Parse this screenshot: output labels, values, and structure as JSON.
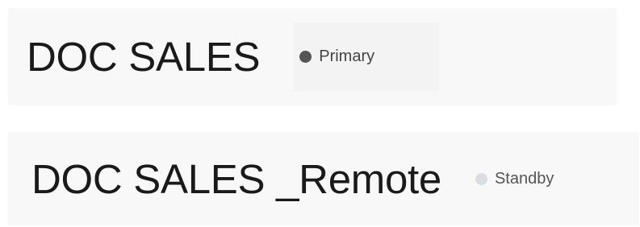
{
  "databases": [
    {
      "name": "DOC SALES",
      "status": "Primary",
      "status_color": "#555555",
      "status_icon": "status-dot-icon"
    },
    {
      "name": "DOC SALES _Remote",
      "status": "Standby",
      "status_color": "#dcdde0",
      "status_icon": "status-dot-icon"
    }
  ]
}
